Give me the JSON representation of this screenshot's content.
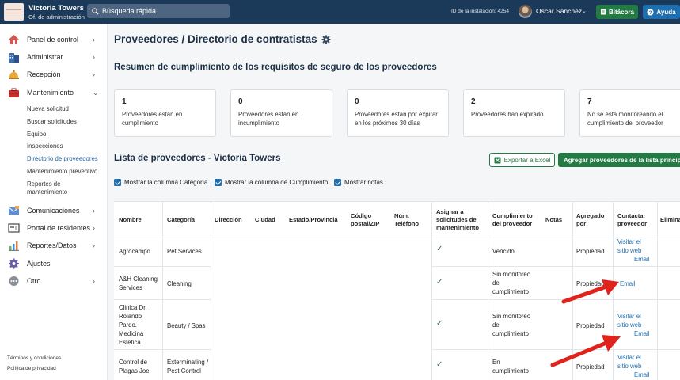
{
  "topbar": {
    "property_name": "Victoria Towers",
    "property_sub": "Of. de administración",
    "search_placeholder": "Búsqueda rápida",
    "install_id": "ID de la instalación: 4254",
    "user_name": "Oscar Sanchez",
    "bitacora_label": "Bitácora",
    "ayuda_label": "Ayuda"
  },
  "sidebar": {
    "items": [
      {
        "label": "Panel de control",
        "icon": "dashboard-icon"
      },
      {
        "label": "Administrar",
        "icon": "building-icon"
      },
      {
        "label": "Recepción",
        "icon": "bell-icon"
      },
      {
        "label": "Mantenimiento",
        "icon": "toolbox-icon"
      },
      {
        "label": "Comunicaciones",
        "icon": "envelope-icon"
      },
      {
        "label": "Portal de residentes",
        "icon": "portal-icon"
      },
      {
        "label": "Reportes/Datos",
        "icon": "chart-icon"
      },
      {
        "label": "Ajustes",
        "icon": "gear-icon"
      },
      {
        "label": "Otro",
        "icon": "more-icon"
      }
    ],
    "sub_items": [
      "Nueva solicitud",
      "Buscar solicitudes",
      "Equipo",
      "Inspecciones",
      "Directorio de proveedores",
      "Mantenimiento preventivo",
      "Reportes de mantenimiento"
    ],
    "footer": [
      "Términos y condiciones",
      "Política de privacidad"
    ]
  },
  "main": {
    "page_title": "Proveedores / Directorio de contratistas",
    "summary_title": "Resumen de cumplimiento de los requisitos de seguro de los proveedores",
    "cards": [
      {
        "num": "1",
        "text": "Proveedores están en cumplimiento"
      },
      {
        "num": "0",
        "text": "Proveedores están en incumplimiento"
      },
      {
        "num": "0",
        "text": "Proveedores están por expirar en los próximos 30 días"
      },
      {
        "num": "2",
        "text": "Proveedores han expirado"
      },
      {
        "num": "7",
        "text": "No se está monitoreando el cumplimiento del proveedor"
      }
    ],
    "list_title": "Lista de proveedores - Victoria Towers",
    "export_label": "Exportar a Excel",
    "add_label": "Agregar proveedores de la lista principal",
    "checkboxes": [
      "Mostrar la columna Categoría",
      "Mostrar la columna de Cumplimiento",
      "Mostrar notas"
    ],
    "columns": [
      "Nombre",
      "Categoría",
      "Dirección",
      "Ciudad",
      "Estado/Provincia",
      "Código postal/ZIP",
      "Núm. Teléfono",
      "Asignar a solicitudes de mantenimiento",
      "Cumplimiento del proveedor",
      "Notas",
      "Agregado por",
      "Contactar proveedor",
      "Eliminar"
    ],
    "rows": [
      {
        "name": "Agrocampo",
        "category": "Pet Services",
        "compliance": "Vencido",
        "added_by": "Propiedad",
        "contact_web": "Visitar el sitio web",
        "contact_email": "Email"
      },
      {
        "name": "A&H Cleaning Services",
        "category": "Cleaning",
        "compliance": "Sin monitoreo del cumplimiento",
        "added_by": "Propiedad",
        "contact_web": "",
        "contact_email": "Email"
      },
      {
        "name": "Clinica Dr. Rolando Pardo. Medicina Estetica",
        "category": "Beauty / Spas",
        "compliance": "Sin monitoreo del cumplimiento",
        "added_by": "Propiedad",
        "contact_web": "Visitar el sitio web",
        "contact_email": "Email"
      },
      {
        "name": "Control de Plagas Joe",
        "category": "Exterminating / Pest Control",
        "compliance": "En cumplimiento",
        "added_by": "Propiedad",
        "contact_web": "Visitar el sitio web",
        "contact_email": "Email"
      }
    ]
  },
  "colors": {
    "topbar": "#1b3a59",
    "green": "#237a45",
    "blue": "#1e6fb0",
    "arrow": "#e0231c"
  }
}
